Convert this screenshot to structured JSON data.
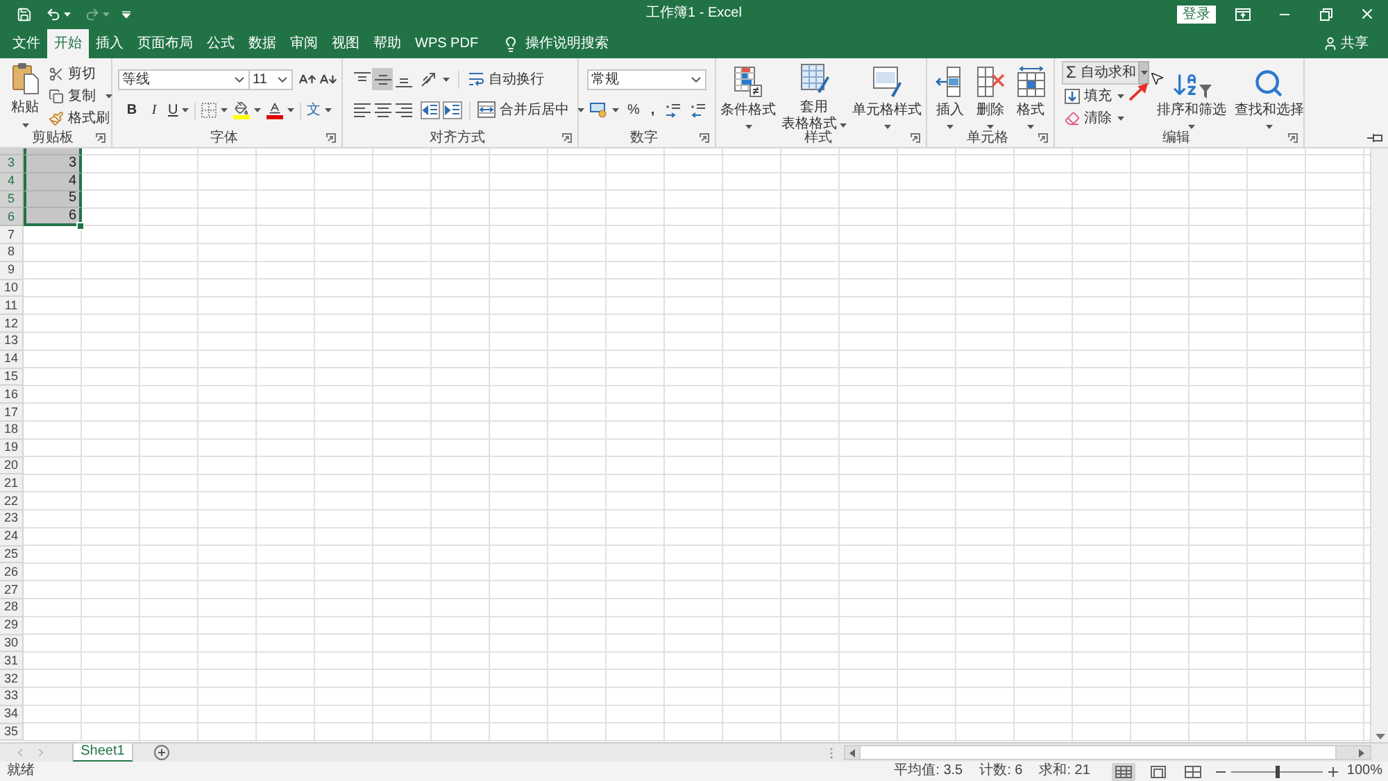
{
  "quick_access": {
    "redo": {
      "disabled": true
    }
  },
  "title_bar": {
    "title": "工作簿1 - Excel",
    "sign_in": "登录"
  },
  "tabs": [
    {
      "label": "文件",
      "selected": false
    },
    {
      "label": "开始",
      "selected": true
    },
    {
      "label": "插入",
      "selected": false
    },
    {
      "label": "页面布局",
      "selected": false
    },
    {
      "label": "公式",
      "selected": false
    },
    {
      "label": "数据",
      "selected": false
    },
    {
      "label": "审阅",
      "selected": false
    },
    {
      "label": "视图",
      "selected": false
    },
    {
      "label": "帮助",
      "selected": false
    },
    {
      "label": "WPS PDF",
      "selected": false
    }
  ],
  "tell_me": "操作说明搜索",
  "share": "共享",
  "ribbon": {
    "clipboard": {
      "label": "剪贴板",
      "paste": "粘贴",
      "cut": "剪切",
      "copy": "复制",
      "format_painter": "格式刷"
    },
    "font": {
      "label": "字体",
      "font_name": "等线",
      "font_size": "11",
      "bold": "B",
      "italic": "I",
      "underline": "U",
      "phonetic": "文"
    },
    "alignment": {
      "label": "对齐方式",
      "vertical": [
        {
          "kind": "top",
          "selected": false
        },
        {
          "kind": "middle",
          "selected": true
        },
        {
          "kind": "bottom",
          "selected": false
        }
      ],
      "wrap_text": "自动换行",
      "merge_center": "合并后居中"
    },
    "number": {
      "label": "数字",
      "format": "常规",
      "percent": "%",
      "comma": ","
    },
    "styles": {
      "label": "样式",
      "conditional_formatting": "条件格式",
      "format_as_table": [
        "套用",
        "表格格式"
      ],
      "cell_styles": "单元格样式"
    },
    "cells": {
      "label": "单元格",
      "insert": "插入",
      "delete": "删除",
      "format": "格式"
    },
    "editing": {
      "label": "编辑",
      "autosum": {
        "symbol": "Σ",
        "label": "自动求和",
        "dropdown_hovered": true
      },
      "fill": "填充",
      "clear": "清除",
      "sort_filter": "排序和筛选",
      "find_select": "查找和选择"
    }
  },
  "grid": {
    "partial_row_selected": true,
    "rows": [
      {
        "number": "3",
        "value": "3",
        "selected": true
      },
      {
        "number": "4",
        "value": "4",
        "selected": true
      },
      {
        "number": "5",
        "value": "5",
        "selected": true
      },
      {
        "number": "6",
        "value": "6",
        "selected": true
      },
      {
        "number": "7",
        "selected": false
      },
      {
        "number": "8",
        "selected": false
      },
      {
        "number": "9",
        "selected": false
      },
      {
        "number": "10",
        "selected": false
      },
      {
        "number": "11",
        "selected": false
      },
      {
        "number": "12",
        "selected": false
      },
      {
        "number": "13",
        "selected": false
      },
      {
        "number": "14",
        "selected": false
      },
      {
        "number": "15",
        "selected": false
      },
      {
        "number": "16",
        "selected": false
      },
      {
        "number": "17",
        "selected": false
      },
      {
        "number": "18",
        "selected": false
      },
      {
        "number": "19",
        "selected": false
      },
      {
        "number": "20",
        "selected": false
      },
      {
        "number": "21",
        "selected": false
      },
      {
        "number": "22",
        "selected": false
      },
      {
        "number": "23",
        "selected": false
      },
      {
        "number": "24",
        "selected": false
      },
      {
        "number": "25",
        "selected": false
      },
      {
        "number": "26",
        "selected": false
      },
      {
        "number": "27",
        "selected": false
      },
      {
        "number": "28",
        "selected": false
      },
      {
        "number": "29",
        "selected": false
      },
      {
        "number": "30",
        "selected": false
      },
      {
        "number": "31",
        "selected": false
      },
      {
        "number": "32",
        "selected": false
      },
      {
        "number": "33",
        "selected": false
      },
      {
        "number": "34",
        "selected": false
      },
      {
        "number": "35",
        "selected": false
      }
    ]
  },
  "sheet_tabs": [
    {
      "label": "Sheet1",
      "selected": true
    }
  ],
  "status_bar": {
    "mode": "就绪",
    "average": "平均值: 3.5",
    "count": "计数: 6",
    "sum": "求和: 21",
    "views": [
      {
        "kind": "normal",
        "selected": true
      },
      {
        "kind": "page_layout",
        "selected": false
      },
      {
        "kind": "page_break",
        "selected": false
      }
    ],
    "zoom": {
      "level": 0.5,
      "reading": "100%"
    }
  }
}
